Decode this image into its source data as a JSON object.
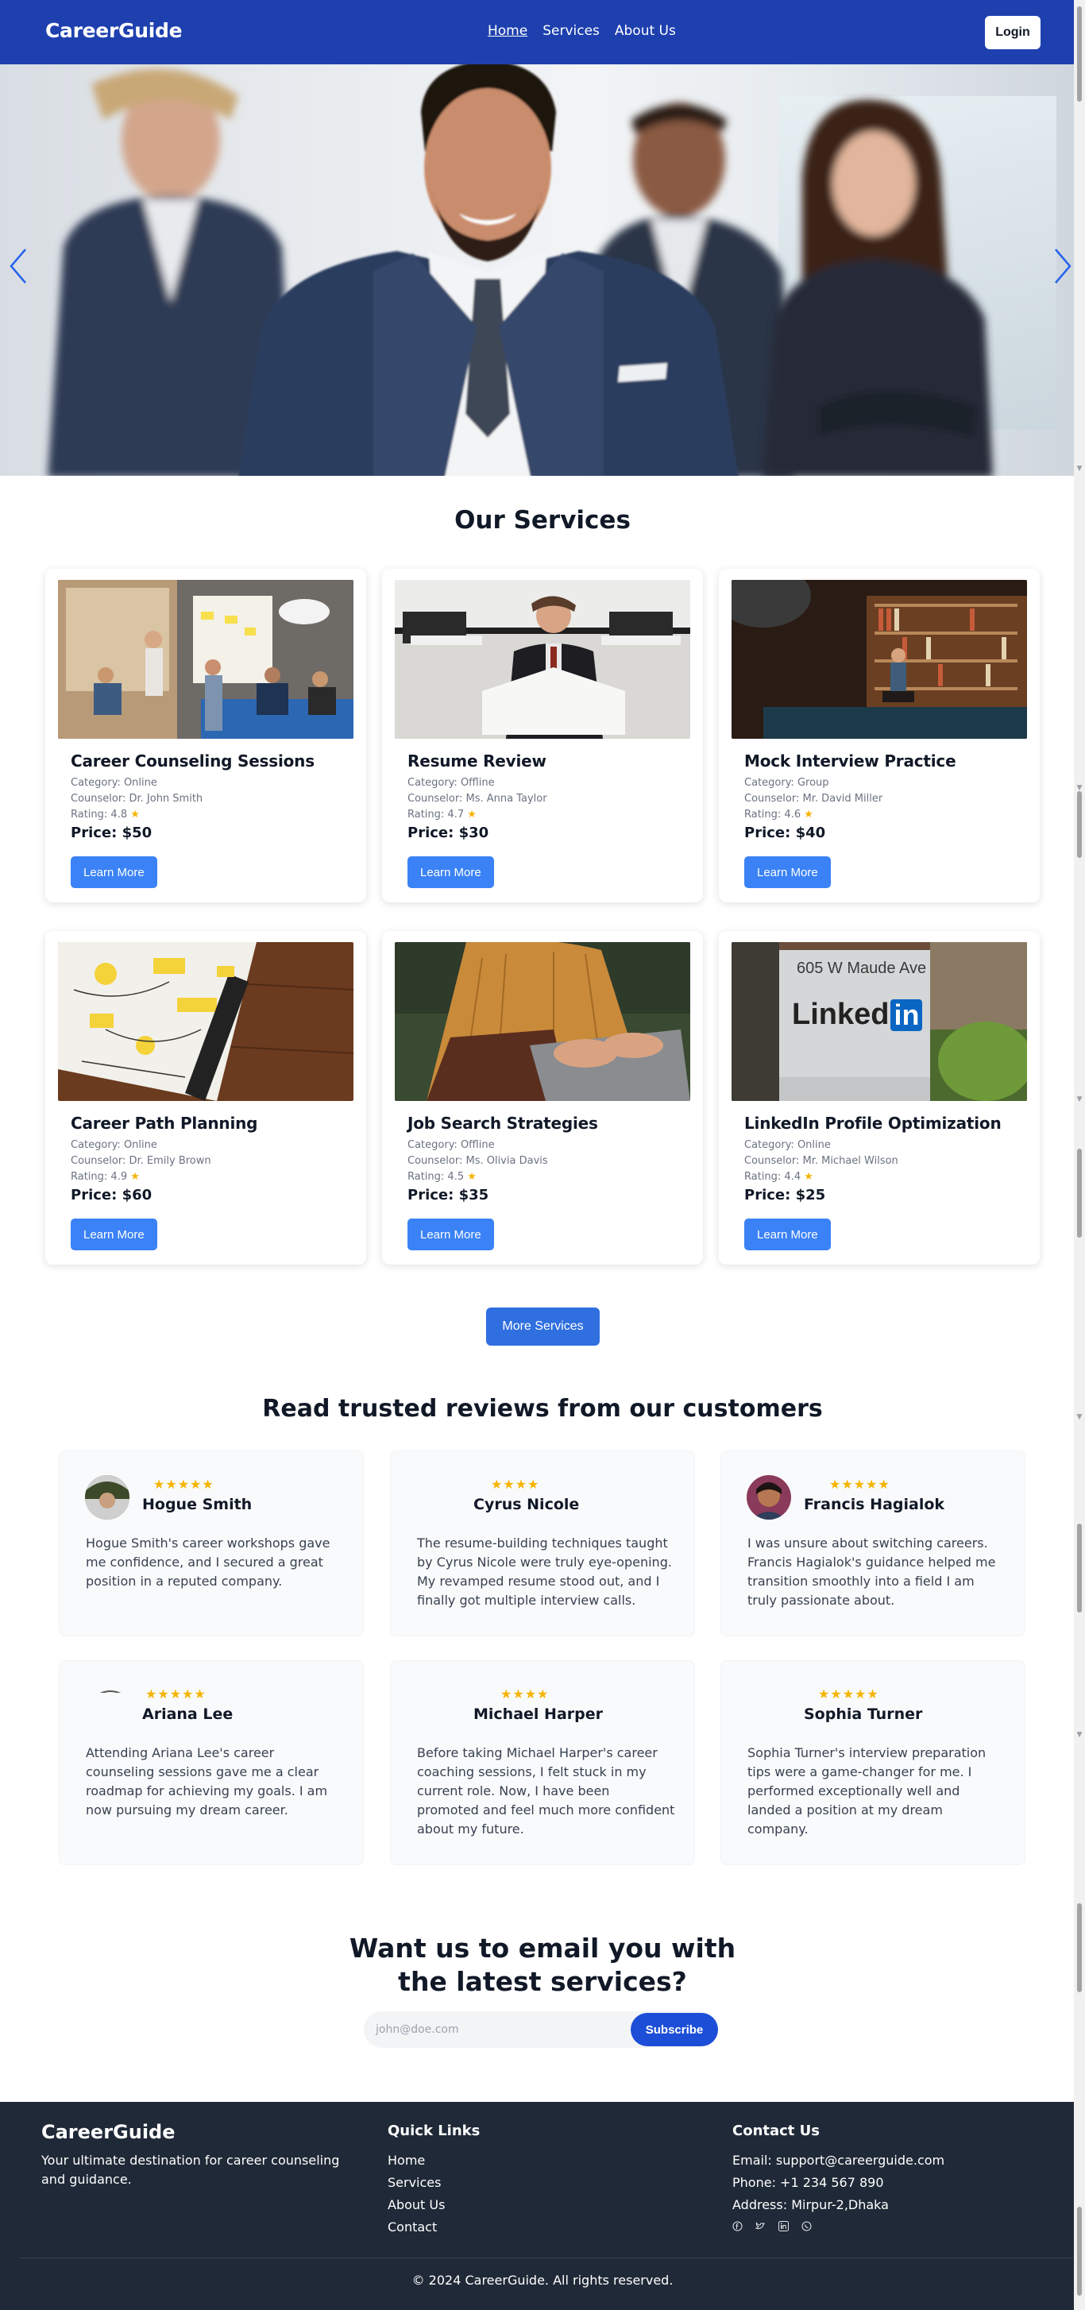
{
  "nav": {
    "brand": "CareerGuide",
    "links": [
      "Home",
      "Services",
      "About Us"
    ],
    "login_label": "Login"
  },
  "hero": {
    "prev_icon": "chevron-left-icon",
    "next_icon": "chevron-right-icon"
  },
  "services": {
    "title": "Our Services",
    "items": [
      {
        "title": "Career Counseling Sessions",
        "category": "Category: Online",
        "counselor": "Counselor: Dr. John Smith",
        "rating": "Rating: 4.8",
        "price": "Price: $50",
        "button": "Learn More"
      },
      {
        "title": "Resume Review",
        "category": "Category: Offline",
        "counselor": "Counselor: Ms. Anna Taylor",
        "rating": "Rating: 4.7",
        "price": "Price: $30",
        "button": "Learn More"
      },
      {
        "title": "Mock Interview Practice",
        "category": "Category: Group",
        "counselor": "Counselor: Mr. David Miller",
        "rating": "Rating: 4.6",
        "price": "Price: $40",
        "button": "Learn More"
      },
      {
        "title": "Career Path Planning",
        "category": "Category: Online",
        "counselor": "Counselor: Dr. Emily Brown",
        "rating": "Rating: 4.9",
        "price": "Price: $60",
        "button": "Learn More"
      },
      {
        "title": "Job Search Strategies",
        "category": "Category: Offline",
        "counselor": "Counselor: Ms. Olivia Davis",
        "rating": "Rating: 4.5",
        "price": "Price: $35",
        "button": "Learn More"
      },
      {
        "title": "LinkedIn Profile Optimization",
        "category": "Category: Online",
        "counselor": "Counselor: Mr. Michael Wilson",
        "rating": "Rating: 4.4",
        "price": "Price: $25",
        "button": "Learn More"
      }
    ],
    "more_label": "More Services",
    "sign_text": "605 W Maude Ave",
    "sign_logo": "Linked",
    "sign_logo_in": "in"
  },
  "reviews": {
    "title": "Read trusted reviews from our customers",
    "items": [
      {
        "name": "Hogue Smith",
        "stars": "★★★★★",
        "text": "Hogue Smith's career workshops gave me confidence, and I secured a great position in a reputed company."
      },
      {
        "name": "Cyrus Nicole",
        "stars": "★★★★",
        "text": "The resume-building techniques taught by Cyrus Nicole were truly eye-opening. My revamped resume stood out, and I finally got multiple interview calls."
      },
      {
        "name": "Francis Hagialok",
        "stars": "★★★★★",
        "text": "I was unsure about switching careers. Francis Hagialok's guidance helped me transition smoothly into a field I am truly passionate about."
      },
      {
        "name": "Ariana Lee",
        "stars": "★★★★★",
        "text": "Attending Ariana Lee's career counseling sessions gave me a clear roadmap for achieving my goals. I am now pursuing my dream career."
      },
      {
        "name": "Michael Harper",
        "stars": "★★★★",
        "text": "Before taking Michael Harper's career coaching sessions, I felt stuck in my current role. Now, I have been promoted and feel much more confident about my future."
      },
      {
        "name": "Sophia Turner",
        "stars": "★★★★★",
        "text": "Sophia Turner's interview preparation tips were a game-changer for me. I performed exceptionally well and landed a position at my dream company."
      }
    ]
  },
  "subscribe": {
    "title_line1": "Want us to email you with",
    "title_line2": "the latest services?",
    "placeholder": "john@doe.com",
    "button": "Subscribe"
  },
  "footer": {
    "brand": "CareerGuide",
    "tagline": "Your ultimate destination for career counseling and guidance.",
    "quick_links_title": "Quick Links",
    "quick_links": [
      "Home",
      "Services",
      "About Us",
      "Contact"
    ],
    "contact_title": "Contact Us",
    "email": "Email: support@careerguide.com",
    "phone": "Phone: +1 234 567 890",
    "address": "Address: Mirpur-2,Dhaka",
    "social_icons": [
      "facebook-icon",
      "twitter-icon",
      "linkedin-icon",
      "whatsapp-icon"
    ],
    "copyright": "© 2024 CareerGuide. All rights reserved."
  },
  "colors": {
    "nav_bg": "#1e40af",
    "accent": "#3b82f6",
    "footer_bg": "#1f2937",
    "star": "#f5b400"
  }
}
